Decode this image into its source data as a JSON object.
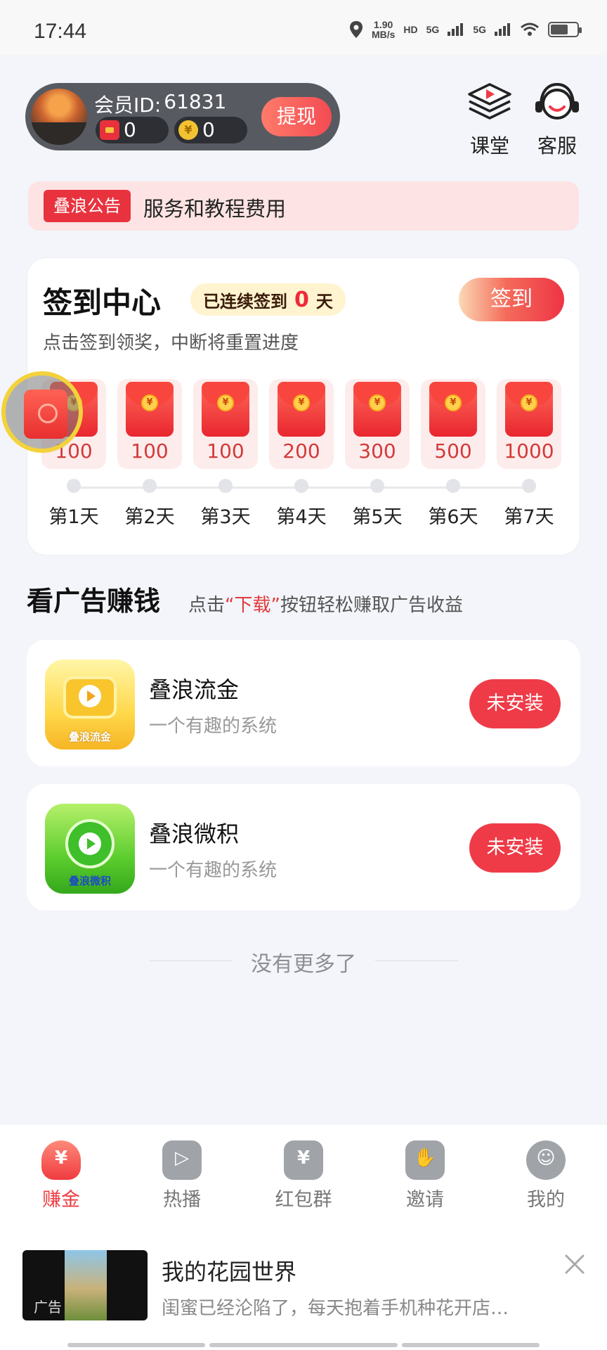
{
  "status_bar": {
    "time": "17:44",
    "speed": "1.90",
    "speed_unit": "MB/s",
    "hd": "HD",
    "sim1": "5G",
    "sim2": "5G"
  },
  "header": {
    "member_label": "会员ID:",
    "member_id": "61831",
    "red_packet_count": "0",
    "coin_count": "0",
    "coin_symbol": "¥",
    "withdraw_label": "提现",
    "class_label": "课堂",
    "service_label": "客服"
  },
  "notice": {
    "tag": "叠浪公告",
    "text": "服务和教程费用"
  },
  "sign_center": {
    "title": "签到中心",
    "streak_prefix": "已连续签到",
    "streak_days": "0",
    "streak_suffix": "天",
    "sign_button": "签到",
    "subtitle": "点击签到领奖，中断将重置进度",
    "coin_symbol": "¥",
    "days": [
      {
        "amount": "100",
        "label": "第1天"
      },
      {
        "amount": "100",
        "label": "第2天"
      },
      {
        "amount": "100",
        "label": "第3天"
      },
      {
        "amount": "200",
        "label": "第4天"
      },
      {
        "amount": "300",
        "label": "第5天"
      },
      {
        "amount": "500",
        "label": "第6天"
      },
      {
        "amount": "1000",
        "label": "第7天"
      }
    ]
  },
  "ads_section": {
    "title": "看广告赚钱",
    "hint_prefix": "点击",
    "hint_highlight": "“下载”",
    "hint_suffix": "按钮轻松赚取广告收益",
    "apps": [
      {
        "name": "叠浪流金",
        "desc": "一个有趣的系统",
        "icon_caption": "叠浪流金",
        "button": "未安装"
      },
      {
        "name": "叠浪微积",
        "desc": "一个有趣的系统",
        "icon_caption": "叠浪微积",
        "button": "未安装"
      }
    ],
    "no_more": "没有更多了"
  },
  "bottom_nav": [
    {
      "label": "赚金",
      "glyph": "¥",
      "active": true
    },
    {
      "label": "热播",
      "glyph": "▷",
      "active": false
    },
    {
      "label": "红包群",
      "glyph": "¥",
      "active": false
    },
    {
      "label": "邀请",
      "glyph": "✋",
      "active": false
    },
    {
      "label": "我的",
      "glyph": "☺",
      "active": false
    }
  ],
  "ad_banner": {
    "tag": "广告",
    "title": "我的花园世界",
    "desc": "闺蜜已经沦陷了，每天抱着手机种花开店…"
  },
  "colors": {
    "accent": "#ef3b48",
    "notice_bg": "#fde3e3",
    "streak_bg": "#fff4cf"
  }
}
